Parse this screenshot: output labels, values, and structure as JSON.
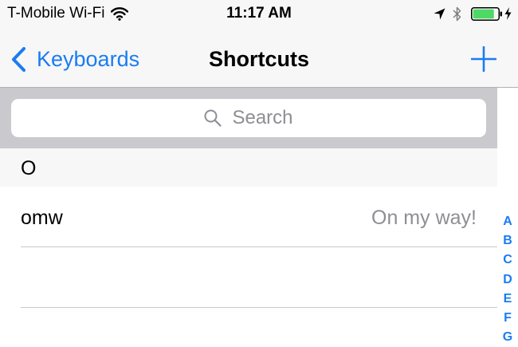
{
  "status_bar": {
    "carrier": "T-Mobile Wi-Fi",
    "time": "11:17 AM",
    "icons": [
      "wifi-icon",
      "location-arrow-icon",
      "bluetooth-icon",
      "battery-icon",
      "charging-bolt-icon"
    ],
    "battery_color": "#4cd964"
  },
  "nav": {
    "back_label": "Keyboards",
    "title": "Shortcuts",
    "add_icon": "plus-icon",
    "accent_color": "#1a7cf3"
  },
  "search": {
    "placeholder": "Search"
  },
  "section": {
    "letter": "O"
  },
  "rows": [
    {
      "shortcut": "omw",
      "phrase": "On my way!"
    },
    {
      "shortcut": "",
      "phrase": ""
    }
  ],
  "index": [
    "A",
    "B",
    "C",
    "D",
    "E",
    "F",
    "G"
  ]
}
